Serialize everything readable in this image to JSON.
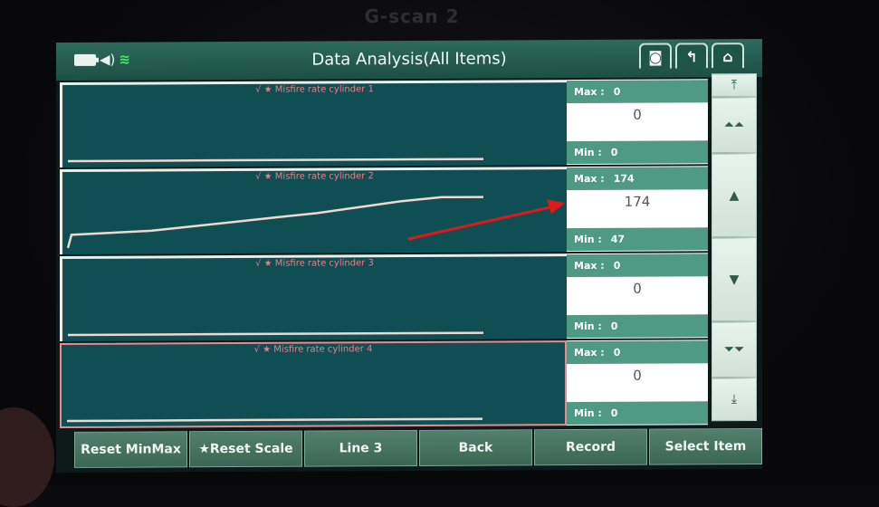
{
  "device": {
    "brand": "G-scan 2"
  },
  "header": {
    "title": "Data Analysis(All Items)",
    "status_icons": [
      "battery-icon",
      "speaker-icon",
      "wifi-icon"
    ],
    "buttons": [
      {
        "name": "capture-button",
        "icon": "camera-icon",
        "glyph": "◙"
      },
      {
        "name": "back-up-button",
        "icon": "return-arrow-icon",
        "glyph": "↰"
      },
      {
        "name": "home-button",
        "icon": "home-icon",
        "glyph": "⌂"
      }
    ]
  },
  "items": [
    {
      "label": "√ ★ Misfire rate cylinder 1",
      "max_label": "Max :",
      "max": "0",
      "current": "0",
      "min_label": "Min :",
      "min": "0",
      "selected": false,
      "trace": [
        0,
        0,
        0,
        0,
        0,
        0,
        0,
        0,
        0,
        0
      ]
    },
    {
      "label": "√ ★ Misfire rate cylinder 2",
      "max_label": "Max :",
      "max": "174",
      "current": "174",
      "min_label": "Min :",
      "min": "47",
      "selected": false,
      "trace": [
        0,
        47,
        60,
        75,
        90,
        105,
        120,
        140,
        160,
        174,
        174
      ]
    },
    {
      "label": "√ ★ Misfire rate cylinder 3",
      "max_label": "Max :",
      "max": "0",
      "current": "0",
      "min_label": "Min :",
      "min": "0",
      "selected": false,
      "trace": [
        0,
        0,
        0,
        0,
        0,
        0,
        0,
        0,
        0,
        0
      ]
    },
    {
      "label": "√ ★ Misfire rate cylinder 4",
      "max_label": "Max :",
      "max": "0",
      "current": "0",
      "min_label": "Min :",
      "min": "0",
      "selected": true,
      "trace": [
        0,
        0,
        0,
        0,
        0,
        0,
        0,
        0,
        0,
        0
      ]
    }
  ],
  "scroll_buttons": [
    {
      "name": "scroll-top-button",
      "icon": "scroll-top-icon",
      "glyph": "⤒"
    },
    {
      "name": "page-up-button",
      "icon": "double-up-icon",
      "glyph": "⏶⏶"
    },
    {
      "name": "line-up-button",
      "icon": "up-triangle-icon",
      "glyph": "▲"
    },
    {
      "name": "line-down-button",
      "icon": "down-triangle-icon",
      "glyph": "▼"
    },
    {
      "name": "page-down-button",
      "icon": "double-down-icon",
      "glyph": "⏷⏷"
    },
    {
      "name": "scroll-bottom-button",
      "icon": "scroll-bottom-icon",
      "glyph": "⤓"
    }
  ],
  "footer": {
    "buttons": [
      "Reset MinMax",
      "★Reset Scale",
      "Line 3",
      "Back",
      "Record",
      "Select Item"
    ]
  },
  "annotation": {
    "type": "red-arrow",
    "points_to": "Misfire rate cylinder 2 current value",
    "color": "#e01818"
  }
}
